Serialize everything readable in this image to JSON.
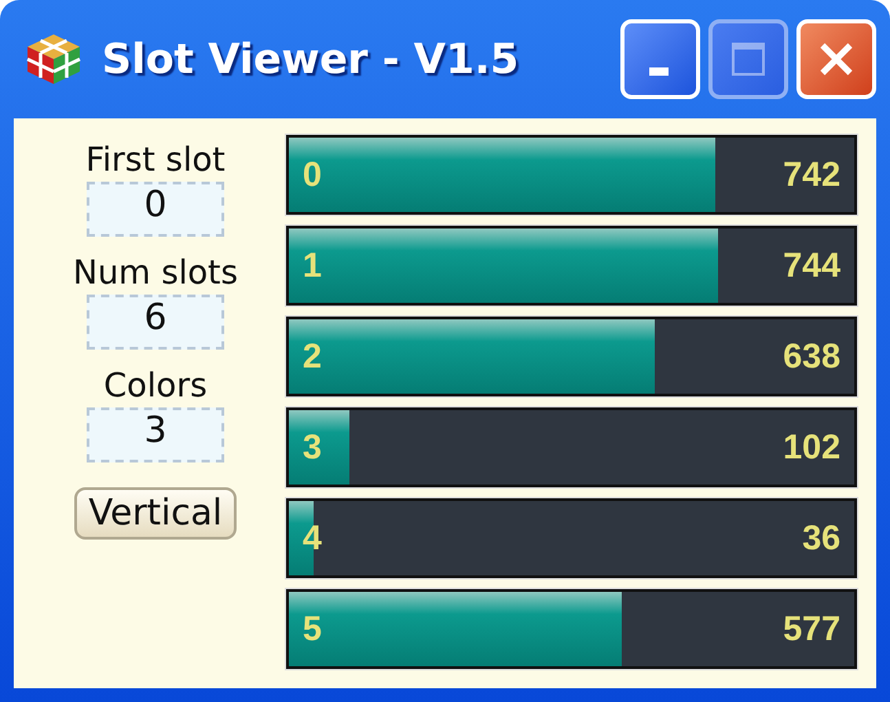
{
  "window": {
    "title": "Slot Viewer - V1.5",
    "controls": [
      {
        "kind": "minimize",
        "disabled": false
      },
      {
        "kind": "maximize",
        "disabled": true
      },
      {
        "kind": "close",
        "disabled": false
      }
    ]
  },
  "settings": [
    {
      "label": "First slot",
      "value": "0"
    },
    {
      "label": "Num slots",
      "value": "6"
    },
    {
      "label": "Colors",
      "value": "3"
    }
  ],
  "buttons": [
    {
      "label": "Vertical"
    }
  ],
  "slots": [
    {
      "index": "0",
      "count": "742",
      "level": 0.754
    },
    {
      "index": "1",
      "count": "744",
      "level": 0.76
    },
    {
      "index": "2",
      "count": "638",
      "level": 0.647
    },
    {
      "index": "3",
      "count": "102",
      "level": 0.106
    },
    {
      "index": "4",
      "count": "36",
      "level": 0.043
    },
    {
      "index": "5",
      "count": "577",
      "level": 0.59
    }
  ]
}
